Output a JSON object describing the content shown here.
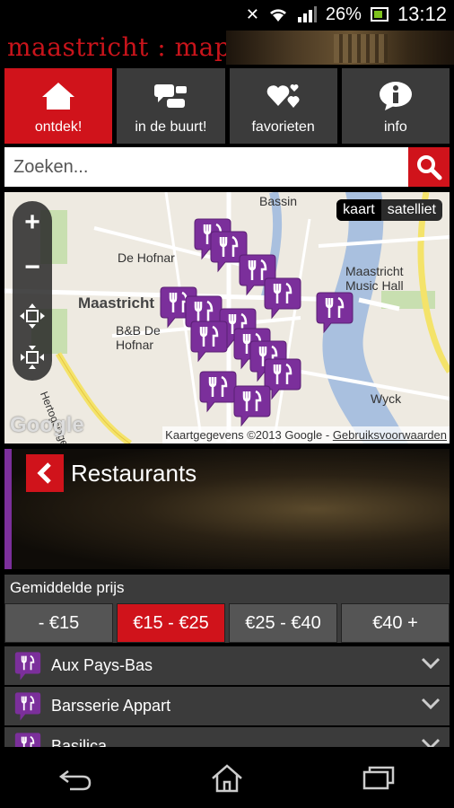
{
  "status": {
    "battery_percent": "26%",
    "time": "13:12"
  },
  "header": {
    "logo": "maastricht : map"
  },
  "tabs": [
    {
      "label": "ontdek!",
      "icon": "home-icon",
      "active": true
    },
    {
      "label": "in de buurt!",
      "icon": "chat-icon",
      "active": false
    },
    {
      "label": "favorieten",
      "icon": "hearts-icon",
      "active": false
    },
    {
      "label": "info",
      "icon": "info-icon",
      "active": false
    }
  ],
  "search": {
    "placeholder": "Zoeken..."
  },
  "map": {
    "type_options": [
      "kaart",
      "satelliet"
    ],
    "selected_type": "kaart",
    "labels": [
      "Maastricht",
      "B&B De Hofnar",
      "De Hofnar",
      "Maastricht Music Hall",
      "Wyck",
      "Bassin",
      "Hertogsingel"
    ],
    "google": "Google",
    "attribution": "Kaartgegevens ©2013 Google - ",
    "terms": "Gebruiksvoorwaarden"
  },
  "category": {
    "title": "Restaurants",
    "accent": "#7b2f9b"
  },
  "price_filter": {
    "label": "Gemiddelde prijs",
    "options": [
      "- €15",
      "€15 - €25",
      "€25 - €40",
      "€40 +"
    ],
    "selected": "€15 - €25"
  },
  "restaurants": [
    "Aux Pays-Bas",
    "Barsserie Appart",
    "Basilica"
  ],
  "colors": {
    "brand_red": "#d0131b",
    "pin_purple": "#7b2f9b",
    "tile_gray": "#3b3b3b"
  }
}
